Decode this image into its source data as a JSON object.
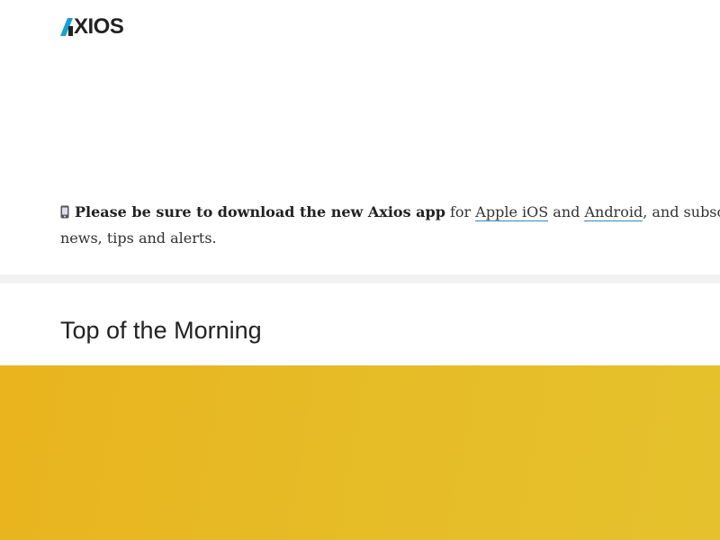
{
  "header": {
    "logo_text": "XIOS",
    "logo_alt": "AXIOS",
    "logo_color": "#1a9fd3"
  },
  "notice": {
    "icon": "mobile-phone-icon",
    "bold_text": "Please be sure to download the new Axios app",
    "text_for": " for ",
    "link_ios": "Apple iOS",
    "text_and": " and ",
    "link_android": "Android",
    "text_rest": ", and subscr",
    "text_line2": "news, tips and alerts."
  },
  "section": {
    "title": "Top of the Morning"
  },
  "hero": {
    "color": "#e7bb25"
  }
}
